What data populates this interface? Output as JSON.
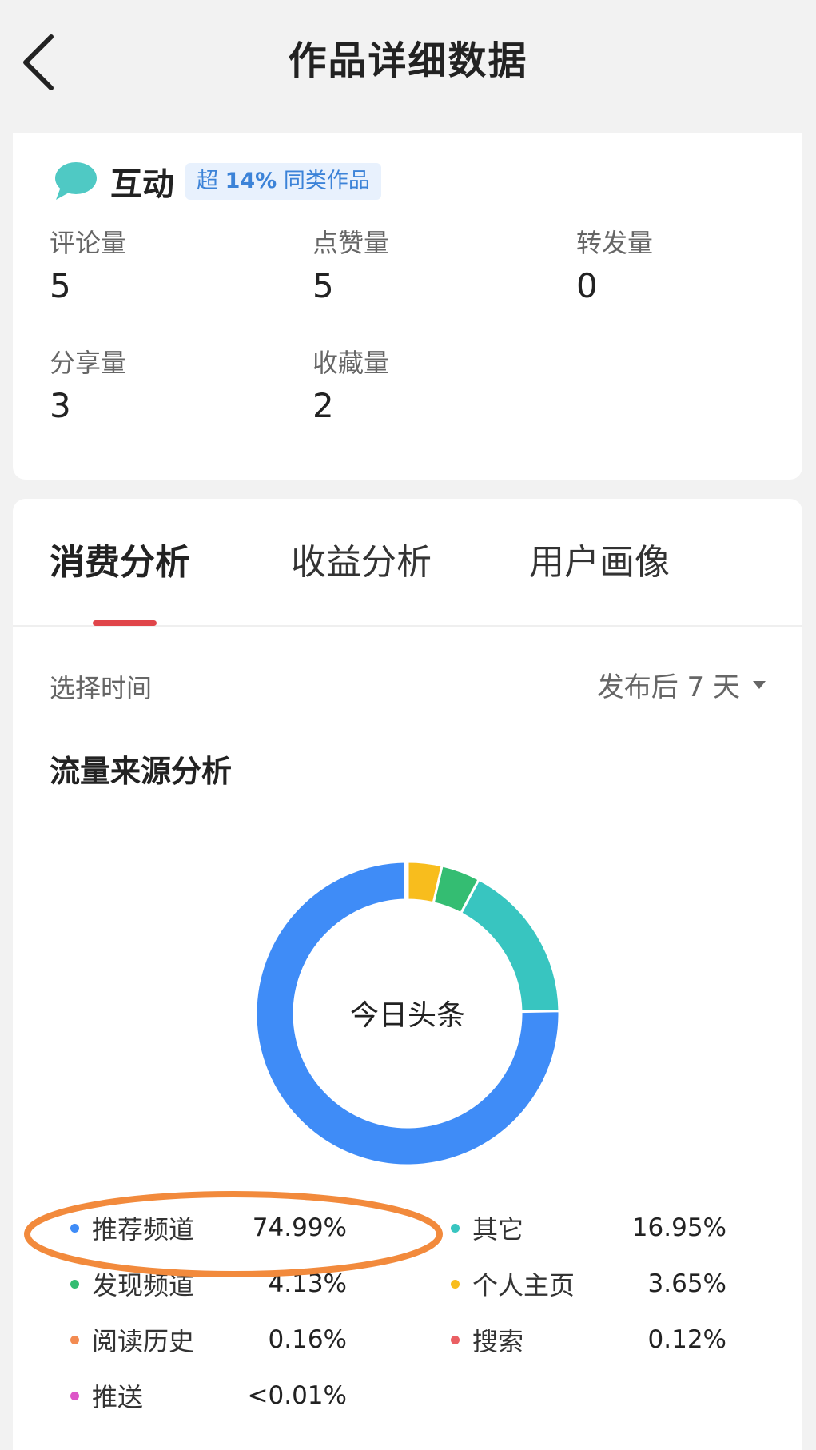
{
  "header": {
    "title": "作品详细数据"
  },
  "interaction": {
    "name": "互动",
    "badge_prefix": "超",
    "badge_value": "14%",
    "badge_suffix": "同类作品",
    "metrics": [
      {
        "label": "评论量",
        "value": "5"
      },
      {
        "label": "点赞量",
        "value": "5"
      },
      {
        "label": "转发量",
        "value": "0"
      },
      {
        "label": "分享量",
        "value": "3"
      },
      {
        "label": "收藏量",
        "value": "2"
      }
    ]
  },
  "tabs": [
    {
      "label": "消费分析",
      "active": true
    },
    {
      "label": "收益分析",
      "active": false
    },
    {
      "label": "用户画像",
      "active": false
    }
  ],
  "time_filter": {
    "label": "选择时间",
    "value": "发布后 7 天"
  },
  "chart_data": {
    "type": "pie",
    "title": "流量来源分析",
    "center_label": "今日头条",
    "series": [
      {
        "name": "推荐频道",
        "value": 74.99,
        "display": "74.99%",
        "color": "#3f8cf7"
      },
      {
        "name": "其它",
        "value": 16.95,
        "display": "16.95%",
        "color": "#38c5c0"
      },
      {
        "name": "发现频道",
        "value": 4.13,
        "display": "4.13%",
        "color": "#34bd72"
      },
      {
        "name": "个人主页",
        "value": 3.65,
        "display": "3.65%",
        "color": "#f8bd1d"
      },
      {
        "name": "阅读历史",
        "value": 0.16,
        "display": "0.16%",
        "color": "#f38b51"
      },
      {
        "name": "搜索",
        "value": 0.12,
        "display": "0.12%",
        "color": "#ea5f63"
      },
      {
        "name": "推送",
        "value": 0.01,
        "display": "<0.01%",
        "color": "#dd56c8"
      }
    ]
  },
  "colors": {
    "accent_tab_underline": "#e0454a",
    "annotation_ellipse": "#f28a3c",
    "badge_text": "#3c83d8"
  }
}
